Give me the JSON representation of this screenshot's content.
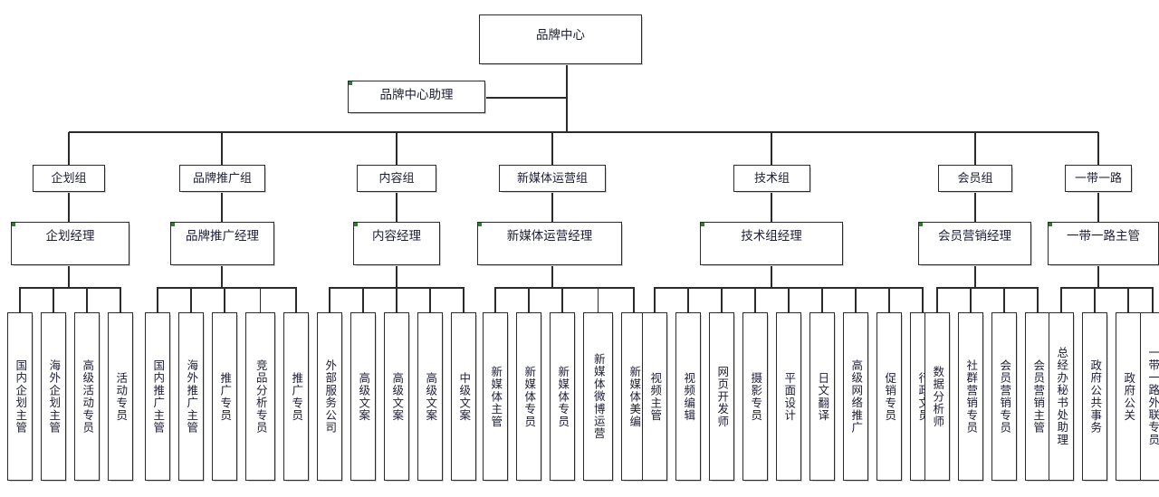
{
  "chart": {
    "title_node": {
      "label": "品牌中心"
    },
    "assistant_node": {
      "label": "品牌中心助理"
    },
    "groups": [
      {
        "unit": "企划组",
        "manager": "企划经理",
        "leaves": [
          "国内企划主管",
          "海外企划主管",
          "高级活动专员",
          "活动专员"
        ]
      },
      {
        "unit": "品牌推广组",
        "manager": "品牌推广经理",
        "leaves": [
          "国内推广主管",
          "海外推广主管",
          "推广专员",
          "竞品分析专员",
          "推广专员"
        ]
      },
      {
        "unit": "内容组",
        "manager": "内容经理",
        "leaves": [
          "外部服务公司",
          "高级文案",
          "高级文案",
          "高级文案",
          "中级文案"
        ]
      },
      {
        "unit": "新媒体运营组",
        "manager": "新媒体运营经理",
        "leaves": [
          "新媒体主管",
          "新媒体专员",
          "新媒体专员",
          "新媒体微博运营",
          "新媒体美编"
        ]
      },
      {
        "unit": "技术组",
        "manager": "技术组经理",
        "leaves": [
          "视频主管",
          "视频编辑",
          "网页开发师",
          "摄影专员",
          "平面设计",
          "日文翻译",
          "高级网络推广",
          "促销专员",
          "行政文员"
        ]
      },
      {
        "unit": "会员组",
        "manager": "会员营销经理",
        "leaves": [
          "数据分析师",
          "社群营销专员",
          "会员营销专员",
          "会员营销主管"
        ]
      },
      {
        "unit": "一带一路",
        "manager": "一带一路主管",
        "leaves": [
          "总经办秘书处助理",
          "政府公共事务",
          "政府公关",
          "一带一路外联专员"
        ]
      }
    ]
  },
  "style": {
    "line_color": "#2b2b2b",
    "box_border": "#2b2b2b",
    "text_color": "#1c1c38",
    "marker_color": "#2f7d32",
    "background": "#ffffff"
  }
}
